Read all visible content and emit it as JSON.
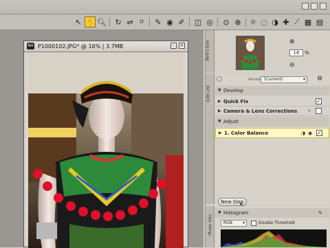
{
  "toolbar": {
    "icons": [
      "pointer-icon",
      "hand-icon",
      "zoom-icon",
      "rotate-icon",
      "straighten-icon",
      "crop-icon",
      "color-picker-icon",
      "red-eye-icon",
      "auto-retouch-icon",
      "selection-brush-icon",
      "lasso-icon",
      "control-point-icon",
      "black-point-icon",
      "white-point-icon",
      "neutral-point-icon",
      "red-eye-control-point-icon",
      "color-point-icon",
      "selection-control-point-icon",
      "grid-icon",
      "compare-icon"
    ]
  },
  "image_window": {
    "title": "P1000102.JPG* @ 16% | 3.7MB",
    "app_icon": "NX"
  },
  "birds_eye": {
    "tab": "Bird's Eye",
    "zoom_value": "16",
    "zoom_unit": "%"
  },
  "edit_list": {
    "tab": "Edit List",
    "version_label": "Version",
    "version_value": "(Current)",
    "develop_label": "Develop",
    "items": [
      {
        "label": "Quick Fix",
        "checked": true
      },
      {
        "label": "Camera & Lens Corrections",
        "checked": false
      }
    ],
    "adjust_label": "Adjust",
    "adjust_items": [
      {
        "label": "1. Color Balance",
        "checked": true
      }
    ],
    "new_step_label": "New Step"
  },
  "photo_info": {
    "tab": "Photo Info",
    "histogram_label": "Histogram",
    "channel": "RGB",
    "double_threshold_label": "Double Threshold"
  },
  "colors": {
    "accent": "#f2cf3b",
    "selected_row": "#fff7c8"
  }
}
